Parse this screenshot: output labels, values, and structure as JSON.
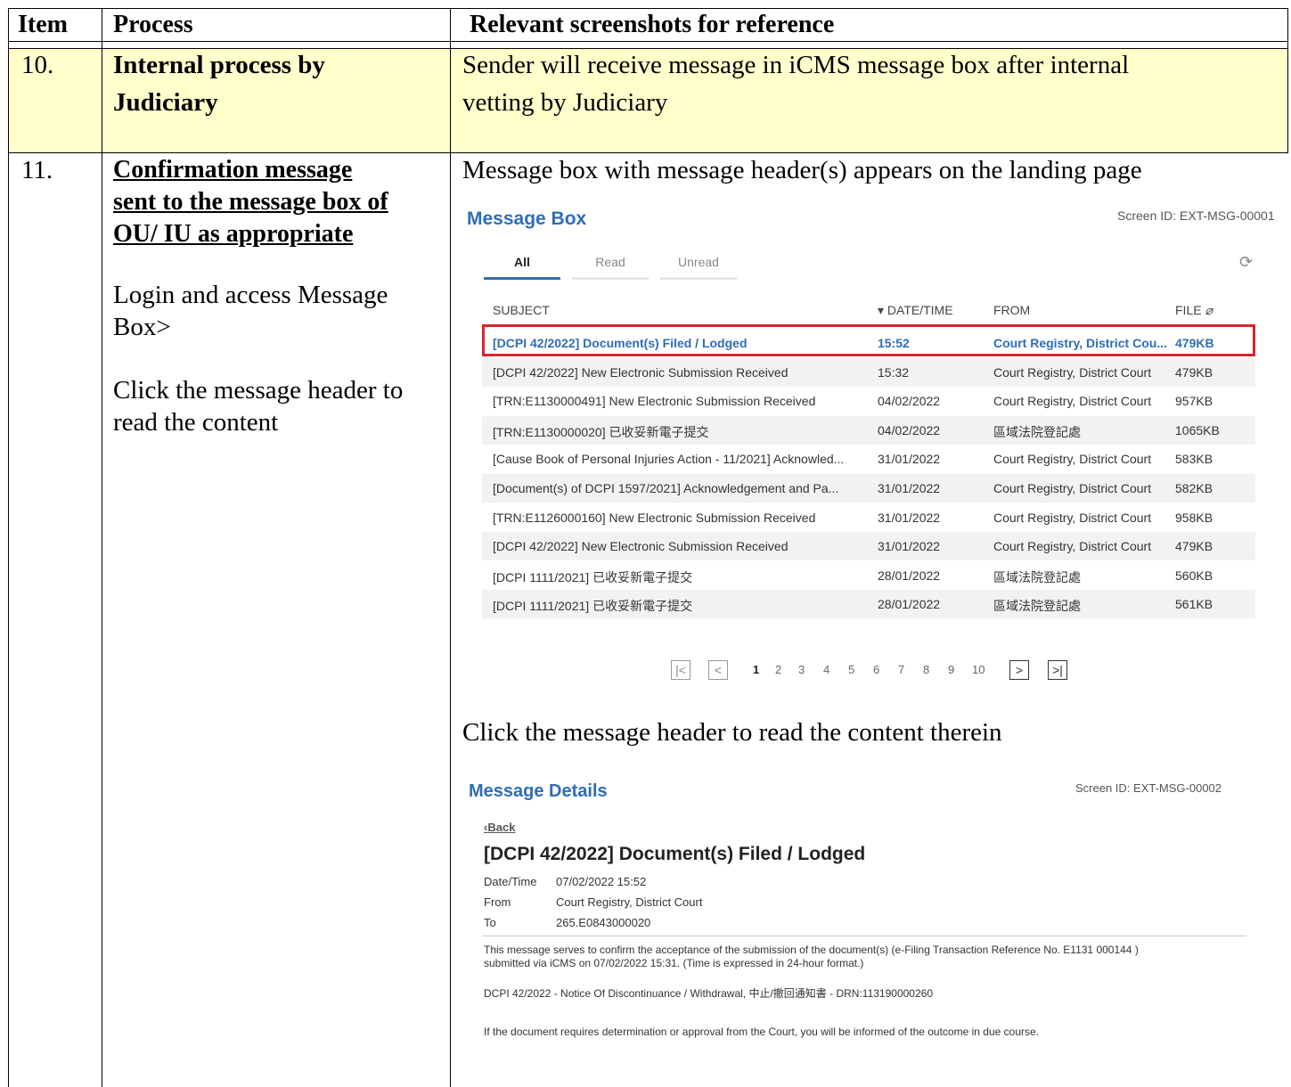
{
  "table": {
    "headers": [
      "Item",
      "Process",
      "Relevant screenshots for reference"
    ],
    "row10": {
      "item": "10.",
      "process_lines": [
        "Internal process by",
        "Judiciary"
      ],
      "reference_lines": [
        "Sender will receive message in iCMS message box after internal",
        "vetting by Judiciary"
      ]
    },
    "row11": {
      "item": "11.",
      "process_title_lines": [
        "Confirmation message",
        "sent to the message box of",
        "OU/ IU as appropriate"
      ],
      "process_step1_lines": [
        "Login and access Message",
        "Box>"
      ],
      "process_step2_lines": [
        "Click the message header to",
        "read the content"
      ],
      "reference_caption1": "Message box with message header(s) appears on the landing page",
      "reference_caption2": "Click the message header to read the content therein"
    }
  },
  "message_box": {
    "title": "Message Box",
    "screen_id": "Screen ID: EXT-MSG-00001",
    "tabs": [
      "All",
      "Read",
      "Unread"
    ],
    "columns": {
      "subject": "SUBJECT",
      "datetime": "▾ DATE/TIME",
      "from": "FROM",
      "file": "FILE"
    },
    "rows": [
      {
        "subject": "[DCPI 42/2022] Document(s) Filed / Lodged",
        "datetime": "15:52",
        "from": "Court Registry, District Cou...",
        "file": "479KB"
      },
      {
        "subject": "[DCPI 42/2022]  New Electronic Submission Received",
        "datetime": "15:32",
        "from": "Court Registry, District Court",
        "file": "479KB"
      },
      {
        "subject": "[TRN:E1130000491] New Electronic Submission Received",
        "datetime": "04/02/2022",
        "from": "Court Registry, District Court",
        "file": "957KB"
      },
      {
        "subject": "[TRN:E1130000020] 已收妥新電子提交",
        "datetime": "04/02/2022",
        "from": "區域法院登記處",
        "file": "1065KB"
      },
      {
        "subject": "[Cause Book of Personal Injuries Action - 11/2021] Acknowled...",
        "datetime": "31/01/2022",
        "from": "Court Registry, District Court",
        "file": "583KB"
      },
      {
        "subject": "[Document(s) of DCPI 1597/2021] Acknowledgement and Pa...",
        "datetime": "31/01/2022",
        "from": "Court Registry, District Court",
        "file": "582KB"
      },
      {
        "subject": "[TRN:E1126000160] New Electronic Submission Received",
        "datetime": "31/01/2022",
        "from": "Court Registry, District Court",
        "file": "958KB"
      },
      {
        "subject": "[DCPI 42/2022] New Electronic Submission Received",
        "datetime": "31/01/2022",
        "from": "Court Registry, District Court",
        "file": "479KB"
      },
      {
        "subject": "[DCPI 1111/2021] 已收妥新電子提交",
        "datetime": "28/01/2022",
        "from": "區域法院登記處",
        "file": "560KB"
      },
      {
        "subject": "[DCPI 1111/2021] 已收妥新電子提交",
        "datetime": "28/01/2022",
        "from": "區域法院登記處",
        "file": "561KB"
      }
    ],
    "pagination": {
      "pages": [
        "1",
        "2",
        "3",
        "4",
        "5",
        "6",
        "7",
        "8",
        "9",
        "10"
      ],
      "current": "1"
    }
  },
  "message_details": {
    "title": "Message Details",
    "screen_id": "Screen ID: EXT-MSG-00002",
    "back": "Back",
    "subject": "[DCPI 42/2022] Document(s) Filed / Lodged",
    "fields": [
      {
        "label": "Date/Time",
        "value": "07/02/2022 15:52"
      },
      {
        "label": "From",
        "value": "Court Registry, District Court"
      },
      {
        "label": "To",
        "value": "265.E0843000020"
      }
    ],
    "body_lines": [
      "This message serves to confirm the acceptance of the submission of the document(s) (e-Filing Transaction Reference No. E1131 000144 )",
      "submitted via  iCMS on 07/02/2022  15:31.  (Time is expressed in 24-hour format.)"
    ],
    "doc_line": "DCPI 42/2022 - Notice Of Discontinuance / Withdrawal, 中止/撤回通知書 - DRN:113190000260",
    "footer_line": "If the document requires determination or approval from the Court, you will be informed of the outcome in due course."
  },
  "colors": {
    "highlight_box": "#d9232d",
    "title_blue": "#2f6db5",
    "header_yellow": "#ffffcc"
  }
}
